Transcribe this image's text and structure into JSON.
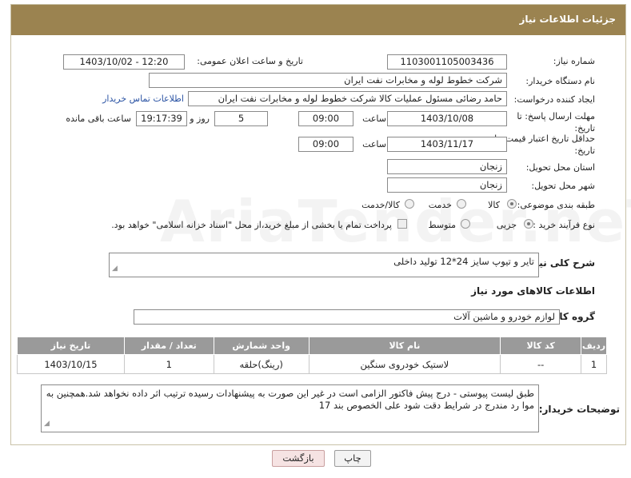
{
  "header": {
    "title": "جزئیات اطلاعات نیاز"
  },
  "watermark": "AriaTender.neT",
  "fields": {
    "need_number_label": "شماره نیاز:",
    "need_number": "1103001105003436",
    "announce_label": "تاریخ و ساعت اعلان عمومی:",
    "announce_value": "1403/10/02 - 12:20",
    "buyer_org_label": "نام دستگاه خریدار:",
    "buyer_org": "شرکت خطوط لوله و مخابرات نفت ایران",
    "creator_label": "ایجاد کننده درخواست:",
    "creator": "حامد  رضائی  مسئول عملیات کالا  شرکت خطوط لوله و مخابرات نفت ایران",
    "contact_link": "اطلاعات تماس خریدار",
    "reply_deadline_label": "مهلت ارسال پاسخ: تا تاریخ:",
    "reply_date": "1403/10/08",
    "time_label": "ساعت",
    "reply_time": "09:00",
    "days": "5",
    "days_label": "روز و",
    "remaining_time": "19:17:39",
    "remaining_label": "ساعت باقی مانده",
    "price_validity_label": "حداقل تاریخ اعتبار قیمت: تا تاریخ:",
    "validity_date": "1403/11/17",
    "validity_time": "09:00",
    "province_label": "استان محل تحویل:",
    "province": "زنجان",
    "city_label": "شهر محل تحویل:",
    "city": "زنجان",
    "category_label": "طبقه بندی موضوعی:",
    "category_options": [
      "کالا",
      "خدمت",
      "کالا/خدمت"
    ],
    "process_label": "نوع فرآیند خرید :",
    "process_options": [
      "جزیی",
      "متوسط"
    ],
    "payment_note": "پرداخت تمام یا بخشی از مبلغ خرید،از محل \"اسناد خزانه اسلامی\" خواهد بود."
  },
  "summary": {
    "label": "شرح کلی نیاز:",
    "text": "تایر و تیوپ سایز 24*12   تولید داخلی"
  },
  "goods": {
    "section_title": "اطلاعات کالاهای مورد نیاز",
    "group_label": "گروه کالا:",
    "group_value": "لوازم خودرو و ماشین آلات"
  },
  "table": {
    "headers": [
      "ردیف",
      "کد کالا",
      "نام کالا",
      "واحد شمارش",
      "تعداد / مقدار",
      "تاریخ نیاز"
    ],
    "rows": [
      [
        "1",
        "--",
        "لاستیک خودروی سنگین",
        "(رینگ)حلقه",
        "1",
        "1403/10/15"
      ]
    ]
  },
  "buyer_notes": {
    "label": "توضیحات خریدار:",
    "text": "طبق لیست پیوستی - درج پیش فاکتور الزامی است در غیر این صورت به پیشنهادات رسیده ترتیب اثر داده نخواهد شد.همچنین به موا رد مندرج در شرایط دقت شود علی الخصوص بند 17"
  },
  "buttons": {
    "print": "چاپ",
    "back": "بازگشت"
  },
  "colors": {
    "header_bg": "#9b8350",
    "table_header_bg": "#9a9a9a",
    "link": "#2952a3"
  }
}
